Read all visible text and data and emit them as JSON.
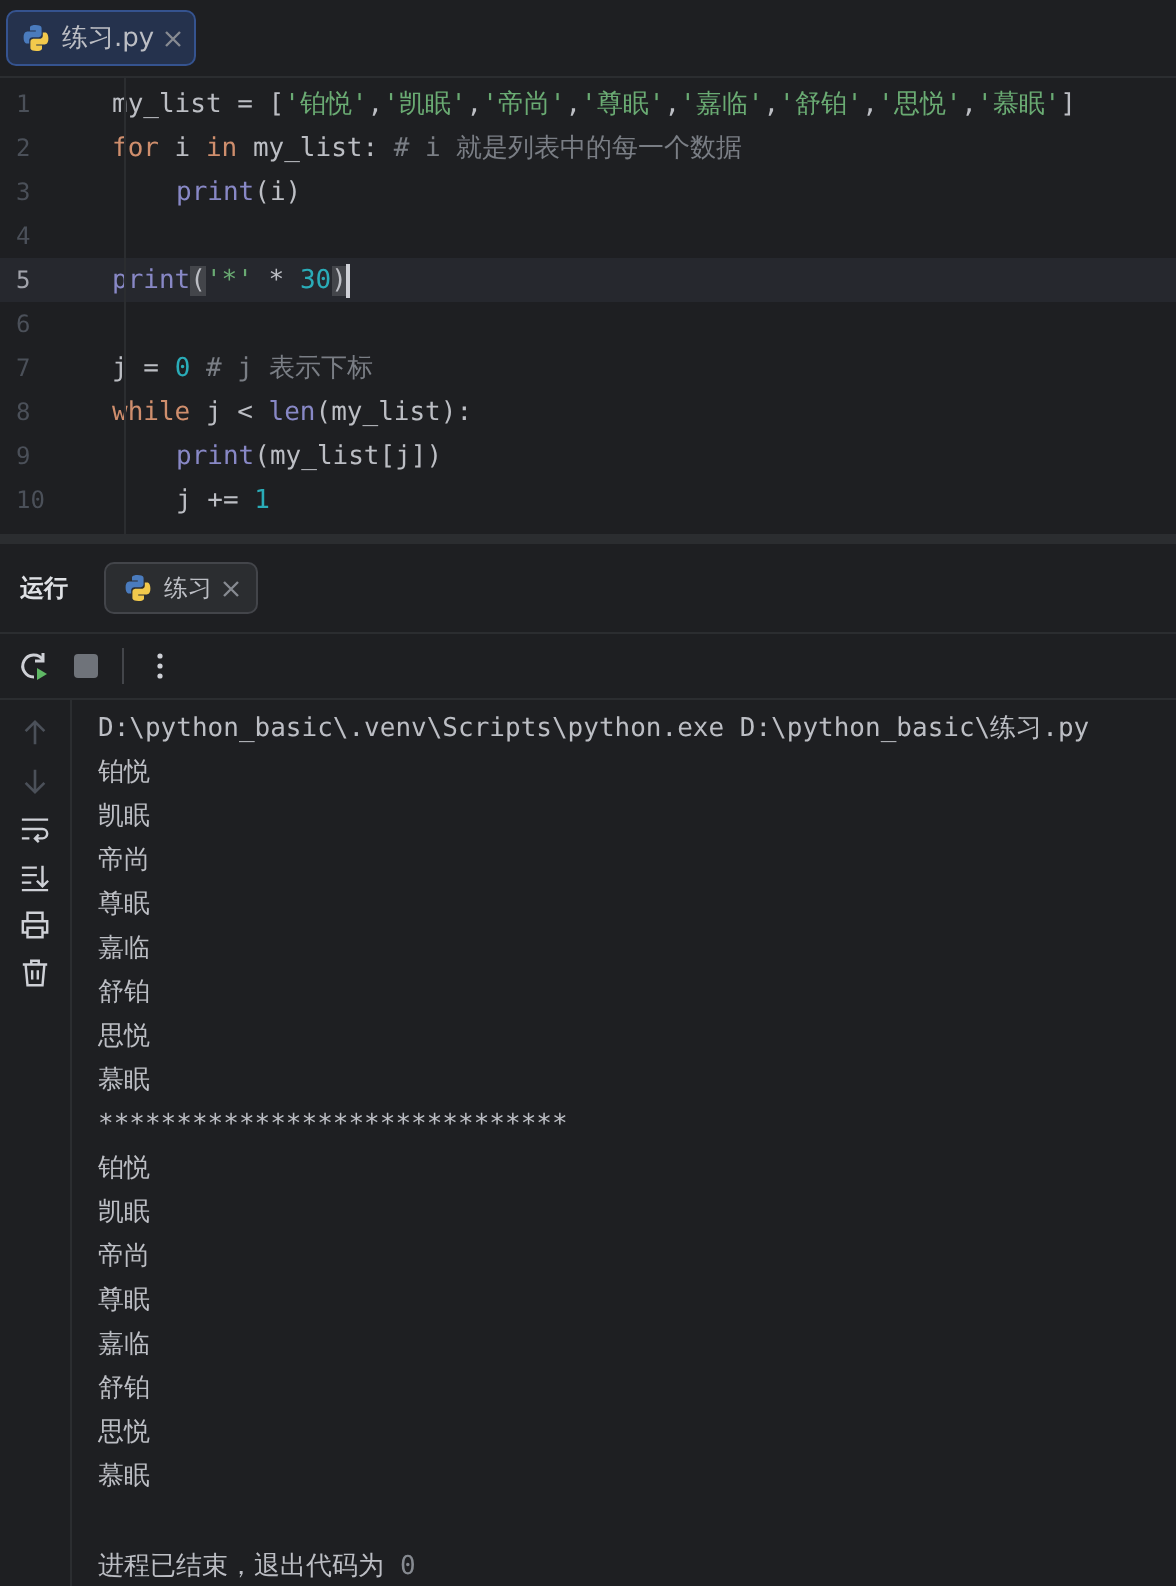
{
  "editor_tabs": [
    {
      "label": "练习.py",
      "selected": true
    }
  ],
  "editor": {
    "lines": [
      {
        "number": "1",
        "current": false,
        "tokens": [
          {
            "kind": "plain",
            "text": "my_list = ["
          },
          {
            "kind": "string",
            "text": "'铂悦'"
          },
          {
            "kind": "plain",
            "text": ","
          },
          {
            "kind": "string",
            "text": "'凯眠'"
          },
          {
            "kind": "plain",
            "text": ","
          },
          {
            "kind": "string",
            "text": "'帝尚'"
          },
          {
            "kind": "plain",
            "text": ","
          },
          {
            "kind": "string",
            "text": "'尊眠'"
          },
          {
            "kind": "plain",
            "text": ","
          },
          {
            "kind": "string",
            "text": "'嘉临'"
          },
          {
            "kind": "plain",
            "text": ","
          },
          {
            "kind": "string",
            "text": "'舒铂'"
          },
          {
            "kind": "plain",
            "text": ","
          },
          {
            "kind": "string",
            "text": "'思悦'"
          },
          {
            "kind": "plain",
            "text": ","
          },
          {
            "kind": "string",
            "text": "'慕眠'"
          },
          {
            "kind": "plain",
            "text": "]"
          }
        ]
      },
      {
        "number": "2",
        "current": false,
        "tokens": [
          {
            "kind": "keyword",
            "text": "for"
          },
          {
            "kind": "plain",
            "text": " i "
          },
          {
            "kind": "keyword",
            "text": "in"
          },
          {
            "kind": "plain",
            "text": " my_list: "
          },
          {
            "kind": "comment",
            "text": "# i 就是列表中的每一个数据"
          }
        ]
      },
      {
        "number": "3",
        "current": false,
        "indent": true,
        "tokens": [
          {
            "kind": "builtin",
            "text": "print"
          },
          {
            "kind": "plain",
            "text": "(i)"
          }
        ]
      },
      {
        "number": "4",
        "current": false
      },
      {
        "number": "5",
        "current": true,
        "tokens": [
          {
            "kind": "builtin",
            "text": "print"
          },
          {
            "kind": "match",
            "text": "("
          },
          {
            "kind": "string",
            "text": "'*'"
          },
          {
            "kind": "plain",
            "text": " * "
          },
          {
            "kind": "number",
            "text": "30"
          },
          {
            "kind": "match",
            "text": ")"
          }
        ]
      },
      {
        "number": "6",
        "current": false
      },
      {
        "number": "7",
        "current": false,
        "tokens": [
          {
            "kind": "plain",
            "text": "j = "
          },
          {
            "kind": "number",
            "text": "0"
          },
          {
            "kind": "comment",
            "text": " # j 表示下标"
          }
        ]
      },
      {
        "number": "8",
        "current": false,
        "tokens": [
          {
            "kind": "keyword",
            "text": "while"
          },
          {
            "kind": "plain",
            "text": " j < "
          },
          {
            "kind": "builtin",
            "text": "len"
          },
          {
            "kind": "plain",
            "text": "(my_list):"
          }
        ]
      },
      {
        "number": "9",
        "current": false,
        "indent": true,
        "tokens": [
          {
            "kind": "builtin",
            "text": "print"
          },
          {
            "kind": "plain",
            "text": "(my_list[j])"
          }
        ]
      },
      {
        "number": "10",
        "current": false,
        "indent": true,
        "tokens": [
          {
            "kind": "plain",
            "text": "j += "
          },
          {
            "kind": "number",
            "text": "1"
          }
        ]
      }
    ]
  },
  "run_panel": {
    "title": "运行",
    "tabs": [
      {
        "label": "练习",
        "selected": true
      }
    ],
    "output": {
      "command": "D:\\python_basic\\.venv\\Scripts\\python.exe D:\\python_basic\\练习.py",
      "lines": [
        "铂悦",
        "凯眠",
        "帝尚",
        "尊眠",
        "嘉临",
        "舒铂",
        "思悦",
        "慕眠",
        "******************************",
        "铂悦",
        "凯眠",
        "帝尚",
        "尊眠",
        "嘉临",
        "舒铂",
        "思悦",
        "慕眠"
      ],
      "exit_message": "进程已结束，退出代码为",
      "exit_code": "0"
    }
  }
}
